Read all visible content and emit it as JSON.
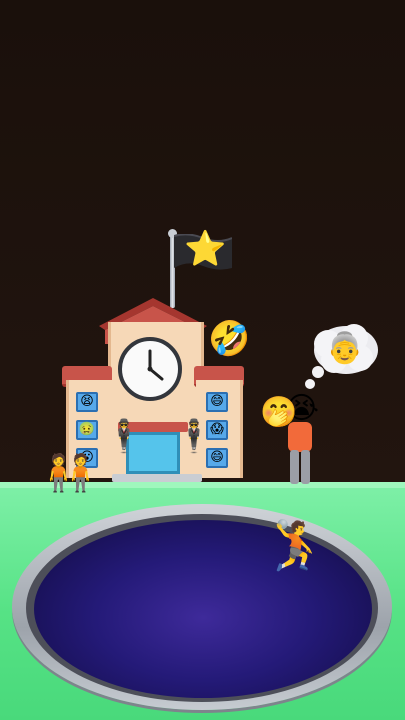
{
  "scene": {
    "background_color": "#1c110c",
    "ground_color": "#56e285",
    "hole_color": "#241a78"
  },
  "icons": {
    "flag": "black-flag-with-star",
    "star": "⭐",
    "building": "school-building",
    "clock": "analog-clock-face",
    "laughing_hand": "🤣",
    "thought_granny": "👵",
    "guards": [
      "🕴",
      "🕴"
    ],
    "window_faces": [
      "😫",
      "🤢",
      "😮",
      "😄",
      "😱",
      "😄"
    ],
    "twins": [
      "🧍",
      "🧍"
    ],
    "grinning_hand": "🤭",
    "crying_person": "😭",
    "falling_player": "🤾"
  }
}
